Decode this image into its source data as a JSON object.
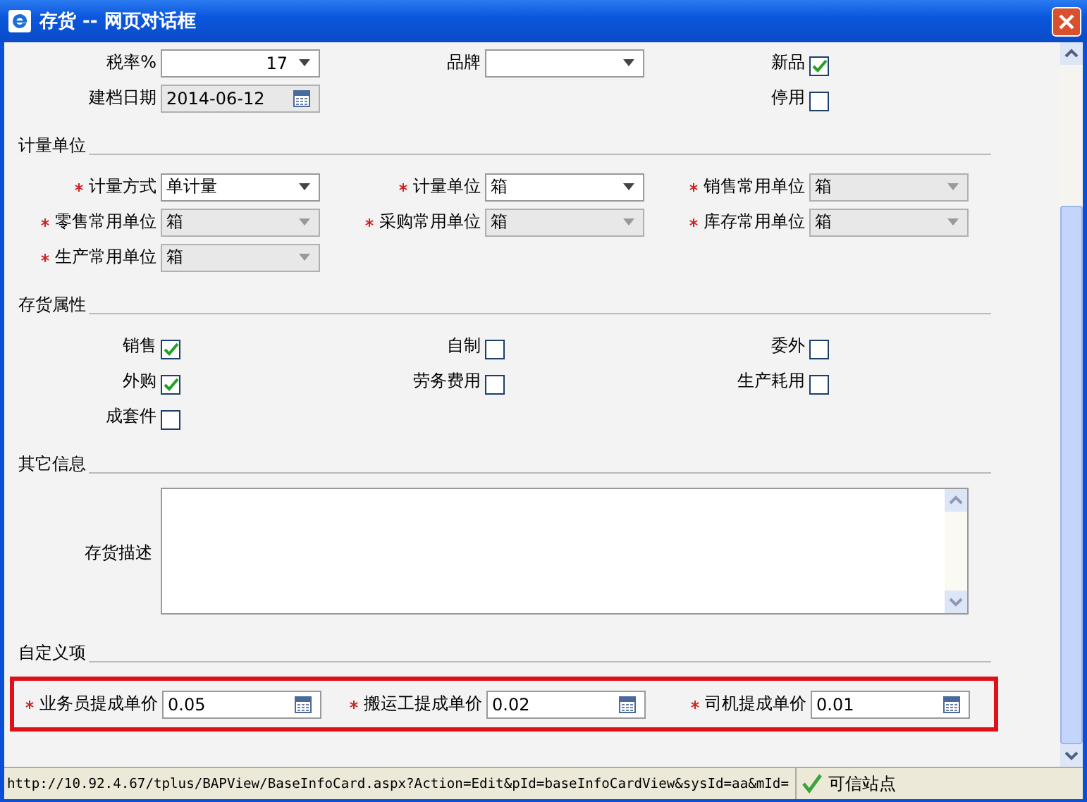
{
  "window": {
    "title": "存货 -- 网页对话框"
  },
  "sections": [
    {
      "rows": [
        [
          {
            "kind": "select",
            "label": "税率%",
            "value": "17",
            "align_right": true
          },
          {
            "kind": "select",
            "label": "品牌"
          },
          {
            "kind": "checkbox",
            "label": "新品",
            "checked": true
          }
        ],
        [
          {
            "kind": "date",
            "label": "建档日期",
            "value": "2014-06-12",
            "disabled": true
          },
          {
            "kind": "empty"
          },
          {
            "kind": "checkbox",
            "label": "停用",
            "checked": false
          }
        ]
      ]
    },
    {
      "heading": "计量单位",
      "rows": [
        [
          {
            "kind": "select",
            "label": "计量方式",
            "value": "单计量",
            "required": true
          },
          {
            "kind": "select",
            "label": "计量单位",
            "value": "箱",
            "required": true
          },
          {
            "kind": "select",
            "label": "销售常用单位",
            "value": "箱",
            "required": true,
            "disabled": true
          }
        ],
        [
          {
            "kind": "select",
            "label": "零售常用单位",
            "value": "箱",
            "required": true,
            "disabled": true
          },
          {
            "kind": "select",
            "label": "采购常用单位",
            "value": "箱",
            "required": true,
            "disabled": true
          },
          {
            "kind": "select",
            "label": "库存常用单位",
            "value": "箱",
            "required": true,
            "disabled": true
          }
        ],
        [
          {
            "kind": "select",
            "label": "生产常用单位",
            "value": "箱",
            "required": true,
            "disabled": true
          }
        ]
      ]
    },
    {
      "heading": "存货属性",
      "rows": [
        [
          {
            "kind": "checkbox",
            "label": "销售",
            "checked": true
          },
          {
            "kind": "checkbox",
            "label": "自制",
            "checked": false
          },
          {
            "kind": "checkbox",
            "label": "委外",
            "checked": false
          }
        ],
        [
          {
            "kind": "checkbox",
            "label": "外购",
            "checked": true
          },
          {
            "kind": "checkbox",
            "label": "劳务费用",
            "checked": false
          },
          {
            "kind": "checkbox",
            "label": "生产耗用",
            "checked": false
          }
        ],
        [
          {
            "kind": "checkbox",
            "label": "成套件",
            "checked": false
          }
        ]
      ]
    },
    {
      "heading": "其它信息",
      "rows": [
        [
          {
            "kind": "textarea",
            "label": "存货描述"
          }
        ]
      ]
    },
    {
      "heading": "自定义项",
      "highlighted": true,
      "rows": [
        [
          {
            "kind": "number",
            "label": "业务员提成单价",
            "value": "0.05",
            "required": true
          },
          {
            "kind": "number",
            "label": "搬运工提成单价",
            "value": "0.02",
            "required": true
          },
          {
            "kind": "number",
            "label": "司机提成单价",
            "value": "0.01",
            "required": true
          }
        ]
      ]
    }
  ],
  "status_bar": {
    "url": "http://10.92.4.67/tplus/BAPView/BaseInfoCard.aspx?Action=Edit&pId=baseInfoCardView&sysId=aa&mId=",
    "zone": "可信站点"
  }
}
